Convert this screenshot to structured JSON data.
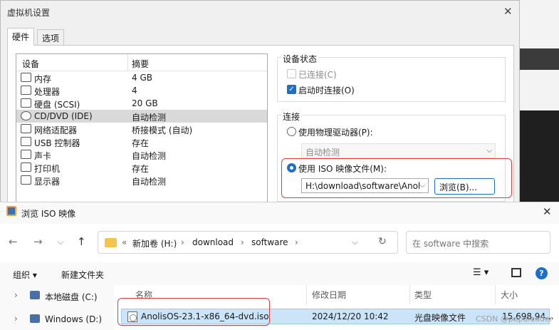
{
  "vm_dialog": {
    "title": "虚拟机设置",
    "tabs": [
      "硬件",
      "选项"
    ],
    "device_list": {
      "headers": [
        "设备",
        "摘要"
      ],
      "rows": [
        {
          "name": "内存",
          "summary": "4 GB",
          "selected": false
        },
        {
          "name": "处理器",
          "summary": "4",
          "selected": false
        },
        {
          "name": "硬盘 (SCSI)",
          "summary": "20 GB",
          "selected": false
        },
        {
          "name": "CD/DVD (IDE)",
          "summary": "自动检测",
          "selected": true
        },
        {
          "name": "网络适配器",
          "summary": "桥接模式 (自动)",
          "selected": false
        },
        {
          "name": "USB 控制器",
          "summary": "存在",
          "selected": false
        },
        {
          "name": "声卡",
          "summary": "自动检测",
          "selected": false
        },
        {
          "name": "打印机",
          "summary": "存在",
          "selected": false
        },
        {
          "name": "显示器",
          "summary": "自动检测",
          "selected": false
        }
      ]
    },
    "device_status": {
      "title": "设备状态",
      "connected_label": "已连接(C)",
      "connected_checked": false,
      "connect_at_power_on_label": "启动时连接(O)",
      "connect_at_power_on_checked": true
    },
    "connection": {
      "title": "连接",
      "physical_drive_label": "使用物理驱动器(P):",
      "physical_drive_value": "自动检测",
      "iso_label": "使用 ISO 映像文件(M):",
      "iso_path": "H:\\download\\software\\Anol",
      "browse_label": "浏览(B)...",
      "selected_option": "iso"
    },
    "close_glyph": "✕"
  },
  "file_dialog": {
    "title": "浏览 ISO 映像",
    "close_glyph": "✕",
    "breadcrumb": [
      "«",
      "新加卷 (H:)",
      "download",
      "software"
    ],
    "search_placeholder": "在 software 中搜索",
    "toolbar": {
      "organize": "组织 ▾",
      "new_folder": "新建文件夹"
    },
    "tree": [
      {
        "label": "本地磁盘 (C:)"
      },
      {
        "label": "Windows (D:)"
      }
    ],
    "columns": [
      "名称",
      "修改日期",
      "类型",
      "大小"
    ],
    "files": [
      {
        "name": "AnolisOS-23.1-x86_64-dvd.iso",
        "modified": "2024/12/20 10:42",
        "type": "光盘映像文件",
        "size": "15,698,94..."
      }
    ]
  },
  "watermark": "CSDN @papaleader",
  "colors": {
    "accent": "#1f6fc9",
    "highlight": "#e03c3c",
    "selection": "#cce4f7"
  }
}
